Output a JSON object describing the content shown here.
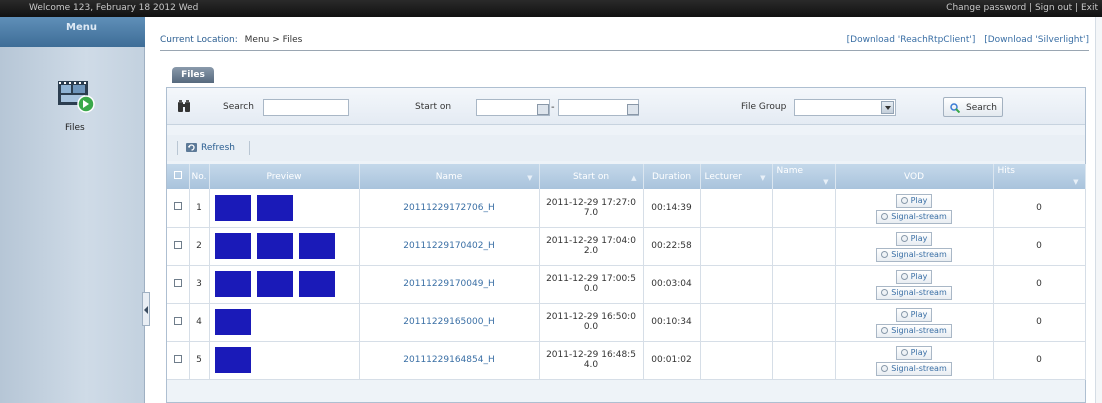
{
  "topbar": {
    "welcome": "Welcome 123, February 18 2012 Wed",
    "links": "Change password | Sign out | Exit"
  },
  "sidebar": {
    "menu_title": "Menu",
    "items": [
      {
        "label": "Files",
        "icon": "film-icon"
      }
    ]
  },
  "breadcrumb": {
    "label": "Current Location:",
    "path": "Menu > Files"
  },
  "downloads": {
    "client": "[Download 'ReachRtpClient']",
    "silverlight": "[Download 'Silverlight']"
  },
  "tabs": [
    {
      "label": "Files",
      "active": true
    }
  ],
  "search": {
    "search_label": "Search",
    "search_value": "",
    "start_on_label": "Start on",
    "start_from": "",
    "start_to": "",
    "dash": "-",
    "file_group_label": "File Group",
    "file_group_value": "",
    "button_label": "Search"
  },
  "toolbar": {
    "refresh_label": "Refresh"
  },
  "table": {
    "columns": [
      "No.",
      "Preview",
      "Name",
      "Start on",
      "Duration",
      "Lecturer",
      "Name",
      "VOD",
      "Hits"
    ],
    "sort_markers": {
      "name": "▼",
      "start_on": "▲",
      "lecturer": "▼",
      "name2": "▼",
      "hits": "▼"
    },
    "vod_play_label": "Play",
    "vod_stream_label": "Signal-stream",
    "rows": [
      {
        "no": "1",
        "thumbs": 2,
        "name": "20111229172706_H",
        "start_line1": "2011-12-29 17:27:0",
        "start_line2": "7.0",
        "duration": "00:14:39",
        "lecturer": "",
        "name2": "",
        "hits": "0"
      },
      {
        "no": "2",
        "thumbs": 3,
        "name": "20111229170402_H",
        "start_line1": "2011-12-29 17:04:0",
        "start_line2": "2.0",
        "duration": "00:22:58",
        "lecturer": "",
        "name2": "",
        "hits": "0"
      },
      {
        "no": "3",
        "thumbs": 3,
        "name": "20111229170049_H",
        "start_line1": "2011-12-29 17:00:5",
        "start_line2": "0.0",
        "duration": "00:03:04",
        "lecturer": "",
        "name2": "",
        "hits": "0"
      },
      {
        "no": "4",
        "thumbs": 1,
        "name": "20111229165000_H",
        "start_line1": "2011-12-29 16:50:0",
        "start_line2": "0.0",
        "duration": "00:10:34",
        "lecturer": "",
        "name2": "",
        "hits": "0"
      },
      {
        "no": "5",
        "thumbs": 1,
        "name": "20111229164854_H",
        "start_line1": "2011-12-29 16:48:5",
        "start_line2": "4.0",
        "duration": "00:01:02",
        "lecturer": "",
        "name2": "",
        "hits": "0"
      }
    ]
  },
  "colors": {
    "thumb": "#1a1ab8",
    "header_bar": "#111111",
    "link": "#3a6fa5"
  }
}
